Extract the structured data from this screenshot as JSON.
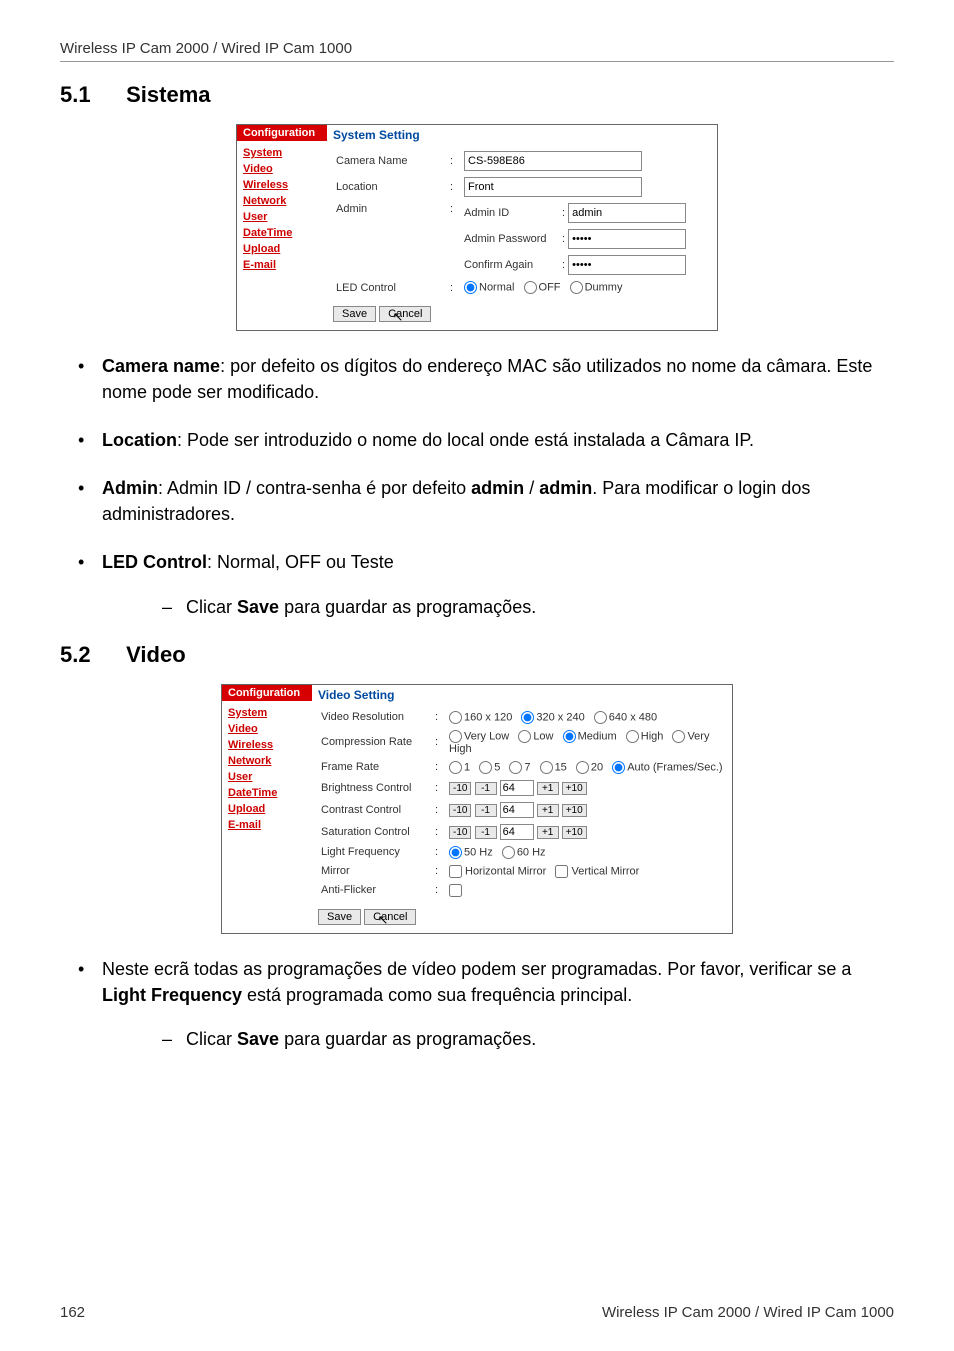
{
  "header": "Wireless IP Cam 2000 / Wired IP Cam 1000",
  "section1": {
    "num": "5.1",
    "title": "Sistema"
  },
  "section2": {
    "num": "5.2",
    "title": "Video"
  },
  "sidebar": {
    "tab": "Configuration",
    "items": [
      "System",
      "Video",
      "Wireless",
      "Network",
      "User",
      "DateTime",
      "Upload",
      "E-mail"
    ]
  },
  "systemPanel": {
    "title": "System Setting",
    "cameraName": {
      "label": "Camera Name",
      "value": "CS-598E86"
    },
    "location": {
      "label": "Location",
      "value": "Front"
    },
    "admin": {
      "label": "Admin",
      "idLabel": "Admin ID",
      "idValue": "admin",
      "pwLabel": "Admin Password",
      "pwValue": "•••••",
      "confirmLabel": "Confirm Again",
      "confirmValue": "•••••"
    },
    "led": {
      "label": "LED Control",
      "opts": [
        "Normal",
        "OFF",
        "Dummy"
      ],
      "selected": "Normal"
    },
    "save": "Save",
    "cancel": "Cancel"
  },
  "videoPanel": {
    "title": "Video Setting",
    "resolution": {
      "label": "Video Resolution",
      "opts": [
        "160 x 120",
        "320 x 240",
        "640 x 480"
      ],
      "selected": "320 x 240"
    },
    "compression": {
      "label": "Compression Rate",
      "opts": [
        "Very Low",
        "Low",
        "Medium",
        "High",
        "Very High"
      ],
      "selected": "Medium"
    },
    "frameRate": {
      "label": "Frame Rate",
      "opts": [
        "1",
        "5",
        "7",
        "15",
        "20",
        "Auto"
      ],
      "selected": "Auto",
      "suffix": "(Frames/Sec.)"
    },
    "brightness": {
      "label": "Brightness Control",
      "value": "64"
    },
    "contrast": {
      "label": "Contrast Control",
      "value": "64"
    },
    "saturation": {
      "label": "Saturation Control",
      "value": "64"
    },
    "stepBtns": [
      "-10",
      "-1",
      "+1",
      "+10"
    ],
    "lightFreq": {
      "label": "Light Frequency",
      "opts": [
        "50 Hz",
        "60 Hz"
      ],
      "selected": "50 Hz"
    },
    "mirror": {
      "label": "Mirror",
      "opts": [
        "Horizontal Mirror",
        "Vertical Mirror"
      ]
    },
    "antiFlicker": {
      "label": "Anti-Flicker"
    },
    "save": "Save",
    "cancel": "Cancel"
  },
  "body": {
    "b1a": "Camera name",
    "b1b": ": por defeito os dígitos do endereço MAC são utilizados no nome da câmara. Este nome pode ser modificado.",
    "b2a": "Location",
    "b2b": ": Pode ser introduzido o nome do local onde está instalada a Câmara IP.",
    "b3a": "Admin",
    "b3b": ": Admin ID / contra-senha é por defeito ",
    "b3c": "admin",
    "b3d": " / ",
    "b3e": "admin",
    "b3f": ". Para modificar o login dos administradores.",
    "b4a": "LED Control",
    "b4b": ": Normal, OFF ou Teste",
    "s1a": "Clicar ",
    "s1b": "Save",
    "s1c": " para guardar as programações.",
    "b5": "Neste ecrã todas as programações de vídeo podem ser programadas. Por favor, verificar se a ",
    "b5b": "Light Frequency",
    "b5c": " está programada como sua frequência principal."
  },
  "footer": {
    "page": "162",
    "title": "Wireless IP Cam 2000 / Wired IP Cam 1000"
  }
}
